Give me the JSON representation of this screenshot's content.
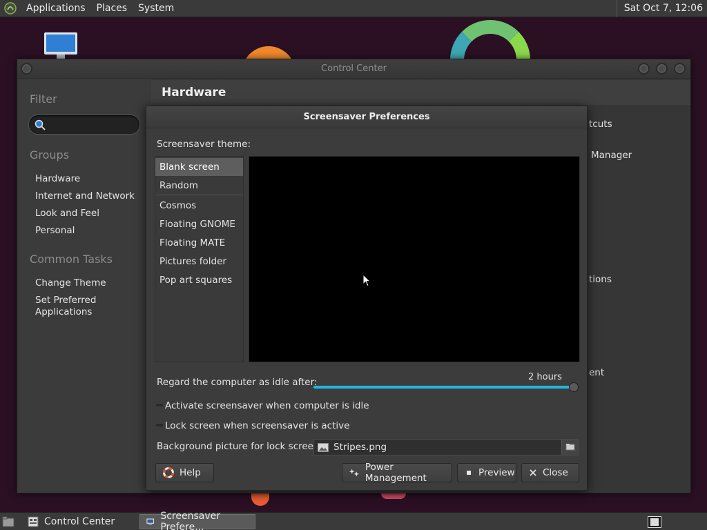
{
  "top_panel": {
    "menus": [
      "Applications",
      "Places",
      "System"
    ],
    "clock": "Sat Oct  7, 12:06"
  },
  "control_center": {
    "title": "Control Center",
    "sidebar": {
      "filter_heading": "Filter",
      "search_placeholder": "",
      "groups_heading": "Groups",
      "groups": [
        "Hardware",
        "Internet and Network",
        "Look and Feel",
        "Personal"
      ],
      "tasks_heading": "Common Tasks",
      "tasks": [
        "Change Theme",
        "Set Preferred",
        "Applications"
      ]
    },
    "main": {
      "section_title": "Hardware",
      "peek_items": [
        "tcuts",
        "Manager",
        "tions",
        "ent"
      ]
    }
  },
  "screensaver_dialog": {
    "title": "Screensaver Preferences",
    "theme_label": "Screensaver theme:",
    "themes": [
      "Blank screen",
      "Random",
      "Cosmos",
      "Floating GNOME",
      "Floating MATE",
      "Pictures folder",
      "Pop art squares"
    ],
    "selected_theme": "Blank screen",
    "idle_label": "Regard the computer as idle after:",
    "idle_value": "2 hours",
    "idle_fraction": 1.0,
    "activate_label": "Activate screensaver when computer is idle",
    "lock_label": "Lock screen when screensaver is active",
    "bg_label": "Background picture for lock screen:",
    "bg_file": "Stripes.png",
    "buttons": {
      "help": "Help",
      "power": "Power Management",
      "preview": "Preview",
      "close": "Close"
    }
  },
  "taskbar": {
    "tasks": [
      "Control Center",
      "Screensaver Prefere..."
    ]
  },
  "colors": {
    "accent": "#2bb3d6",
    "panel": "#3a3a3a",
    "desktop": "#2b1024"
  }
}
